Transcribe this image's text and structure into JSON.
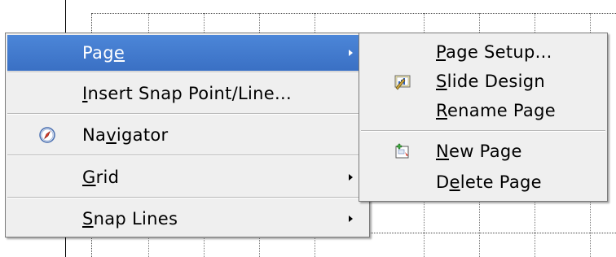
{
  "main_menu": {
    "items": [
      {
        "pre": "Pag",
        "accel": "e",
        "post": "",
        "has_submenu": true,
        "highlighted": true,
        "icon": ""
      },
      {
        "pre": "",
        "accel": "I",
        "post": "nsert Snap Point/Line...",
        "has_submenu": false,
        "highlighted": false,
        "icon": ""
      },
      {
        "pre": "Na",
        "accel": "v",
        "post": "igator",
        "has_submenu": false,
        "highlighted": false,
        "icon": "navigator-compass-icon"
      },
      {
        "pre": "",
        "accel": "G",
        "post": "rid",
        "has_submenu": true,
        "highlighted": false,
        "icon": ""
      },
      {
        "pre": "",
        "accel": "S",
        "post": "nap Lines",
        "has_submenu": true,
        "highlighted": false,
        "icon": ""
      }
    ]
  },
  "page_submenu": {
    "items": [
      {
        "pre": "",
        "accel": "P",
        "post": "age Setup...",
        "icon": ""
      },
      {
        "pre": "",
        "accel": "S",
        "post": "lide Design",
        "icon": "slide-design-icon"
      },
      {
        "pre": "",
        "accel": "R",
        "post": "ename Page",
        "icon": ""
      },
      {
        "pre": "",
        "accel": "N",
        "post": "ew Page",
        "icon": "new-page-icon"
      },
      {
        "pre": "D",
        "accel": "e",
        "post": "lete Page",
        "icon": ""
      }
    ]
  },
  "colors": {
    "highlight": "#3a70c4",
    "menu_background": "#efefef"
  }
}
